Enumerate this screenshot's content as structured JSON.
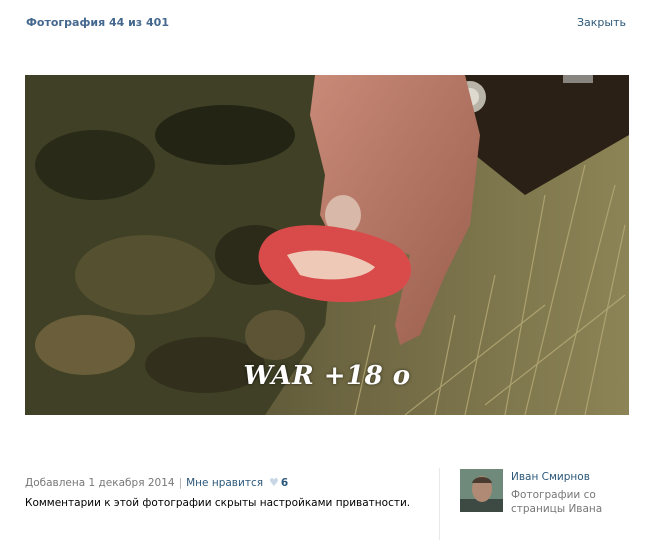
{
  "header": {
    "title": "Фотография 44 из 401",
    "close_label": "Закрыть"
  },
  "photo": {
    "watermark": "WAR +18 o"
  },
  "meta": {
    "added": "Добавлена 1 декабря 2014",
    "separator": "|",
    "like_label": "Мне нравится",
    "like_count": "6",
    "comments_note": "Комментарии к этой фотографии скрыты настройками приватности."
  },
  "author": {
    "name": "Иван Смирнов",
    "source_note": "Фотографии со страницы Ивана"
  },
  "icons": {
    "like": "heart-icon",
    "avatar": "user-avatar"
  },
  "colors": {
    "link": "#2b587a",
    "title": "#45688e",
    "muted": "#777777"
  }
}
